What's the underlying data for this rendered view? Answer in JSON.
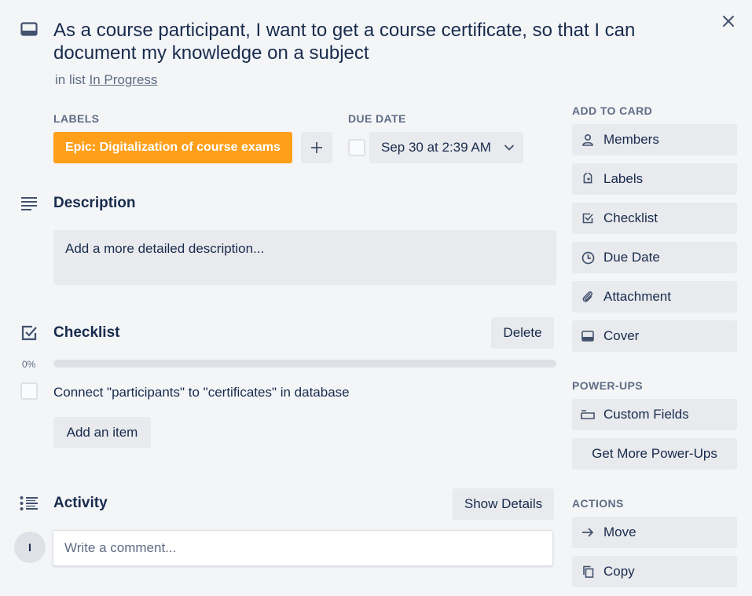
{
  "card": {
    "title": "As a course participant, I want to get a course certificate, so that I can document my knowledge on a subject",
    "list_prefix": "in list",
    "list_name": "In Progress"
  },
  "labels": {
    "heading": "LABELS",
    "items": [
      {
        "text": "Epic: Digitalization of course exams",
        "color": "#ff9f1a"
      }
    ]
  },
  "due_date": {
    "heading": "DUE DATE",
    "value": "Sep 30 at 2:39 AM"
  },
  "description": {
    "heading": "Description",
    "placeholder": "Add a more detailed description..."
  },
  "checklist": {
    "heading": "Checklist",
    "delete_label": "Delete",
    "progress_text": "0%",
    "progress": 0,
    "items": [
      {
        "text": "Connect \"participants\" to \"certificates\" in database",
        "checked": false
      }
    ],
    "add_item_label": "Add an item"
  },
  "activity": {
    "heading": "Activity",
    "show_details_label": "Show Details",
    "avatar_initial": "I",
    "comment_placeholder": "Write a comment..."
  },
  "sidebar": {
    "add_to_card": {
      "heading": "ADD TO CARD",
      "items": [
        {
          "label": "Members",
          "icon": "person-icon"
        },
        {
          "label": "Labels",
          "icon": "tag-icon"
        },
        {
          "label": "Checklist",
          "icon": "checkbox-icon"
        },
        {
          "label": "Due Date",
          "icon": "clock-icon"
        },
        {
          "label": "Attachment",
          "icon": "paperclip-icon"
        },
        {
          "label": "Cover",
          "icon": "cover-icon"
        }
      ]
    },
    "power_ups": {
      "heading": "POWER-UPS",
      "items": [
        {
          "label": "Custom Fields",
          "icon": "custom-fields-icon"
        }
      ],
      "more_label": "Get More Power-Ups"
    },
    "actions": {
      "heading": "ACTIONS",
      "items": [
        {
          "label": "Move",
          "icon": "arrow-right-icon"
        },
        {
          "label": "Copy",
          "icon": "copy-icon"
        }
      ]
    }
  },
  "colors": {
    "background": "#f4f5f7",
    "button": "#e9eaed",
    "text": "#172b4d",
    "muted": "#5e6c84",
    "label_orange": "#ff9f1a"
  }
}
